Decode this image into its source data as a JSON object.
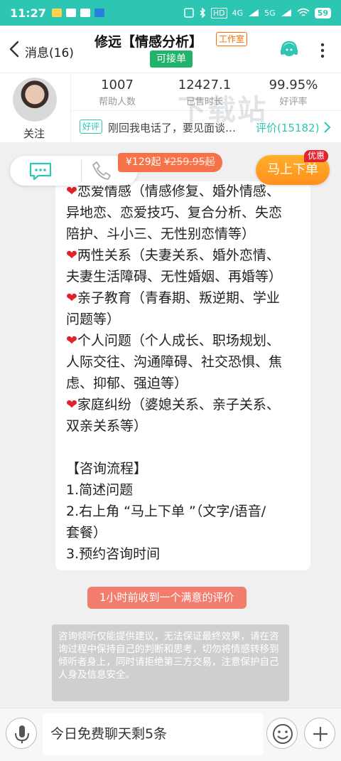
{
  "status_bar": {
    "time": "11:27",
    "network": "4G",
    "network2": "5G",
    "hd": "HD",
    "battery": "59"
  },
  "header": {
    "back_label": "消息(16)",
    "title": "修远【情感分析】",
    "studio_badge": "工作室",
    "accept_badge": "可接单"
  },
  "profile": {
    "follow_label": "关注",
    "stats": [
      {
        "value": "1007",
        "label": "帮助人数"
      },
      {
        "value": "12427.1",
        "label": "已售时长"
      },
      {
        "value": "99.95%",
        "label": "好评率"
      }
    ],
    "review_tag": "好评",
    "review_text": "刚回我电话了，要见面谈…",
    "review_count": "评价(15182)"
  },
  "watermark": "下载站",
  "actions": {
    "price": "¥129起",
    "original_price": "¥259.95起",
    "order_button": "马上下单",
    "discount_badge": "优惠"
  },
  "message": {
    "lines": [
      {
        "heart": true,
        "text": "恋爱情感（情感修复、婚外情感、"
      },
      {
        "heart": false,
        "text": "异地恋、恋爱技巧、复合分析、失恋"
      },
      {
        "heart": false,
        "text": "陪护、斗小三、无性别恋情等）"
      },
      {
        "heart": true,
        "text": "两性关系（夫妻关系、婚外恋情、"
      },
      {
        "heart": false,
        "text": "夫妻生活障碍、无性婚姻、再婚等）"
      },
      {
        "heart": true,
        "text": "亲子教育（青春期、叛逆期、学业"
      },
      {
        "heart": false,
        "text": "问题等）"
      },
      {
        "heart": true,
        "text": "个人问题（个人成长、职场规划、"
      },
      {
        "heart": false,
        "text": "人际交往、沟通障碍、社交恐惧、焦"
      },
      {
        "heart": false,
        "text": "虑、抑郁、强迫等）"
      },
      {
        "heart": true,
        "text": "家庭纠纷（婆媳关系、亲子关系、"
      },
      {
        "heart": false,
        "text": "双亲关系等）"
      },
      {
        "heart": false,
        "text": ""
      },
      {
        "heart": false,
        "text": "【咨询流程】"
      },
      {
        "heart": false,
        "text": "1.简述问题"
      },
      {
        "heart": false,
        "text": "2.右上角 “马上下单 ”（文字/语音/"
      },
      {
        "heart": false,
        "text": "套餐）"
      },
      {
        "heart": false,
        "text": "3.预约咨询时间"
      }
    ]
  },
  "notice": "1小时前收到一个满意的评价",
  "disclaimer": "咨询倾听仅能提供建议，无法保证最终效果，请在咨询过程中保持自己的判断和思考，切勿将情感转移到倾听者身上，同时请拒绝第三方交易，注意保护自己人身及信息安全。",
  "input": {
    "text": "今日免费聊天剩5条"
  },
  "colors": {
    "accent": "#2dc6b3",
    "order_orange": "#ff9a22",
    "price_tag": "#f6734a",
    "heart_red": "#e0232b",
    "accept_green": "#21b36a"
  },
  "icons": [
    "back-arrow-icon",
    "customer-service-icon",
    "more-icon",
    "chat-icon",
    "phone-icon",
    "chevron-right-icon",
    "microphone-icon",
    "emoji-icon",
    "plus-icon"
  ]
}
